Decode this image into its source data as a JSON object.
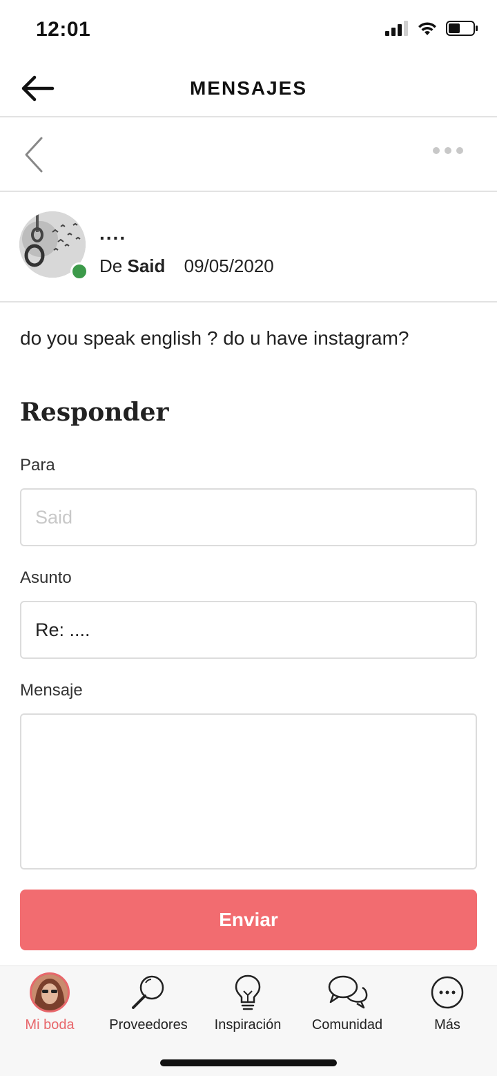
{
  "status_bar": {
    "time": "12:01"
  },
  "nav": {
    "title": "MENSAJES"
  },
  "message": {
    "subject": "....",
    "from_prefix": "De",
    "sender": "Said",
    "date": "09/05/2020",
    "body": "do you speak english ? do u have instagram?"
  },
  "reply": {
    "title": "Responder",
    "to_label": "Para",
    "to_placeholder": "Said",
    "subject_label": "Asunto",
    "subject_value": "Re: ....",
    "message_label": "Mensaje",
    "message_value": "",
    "send_label": "Enviar"
  },
  "tabs": [
    {
      "label": "Mi boda",
      "icon": "avatar-icon",
      "active": true
    },
    {
      "label": "Proveedores",
      "icon": "magnifier-icon",
      "active": false
    },
    {
      "label": "Inspiración",
      "icon": "lightbulb-icon",
      "active": false
    },
    {
      "label": "Comunidad",
      "icon": "chat-bubbles-icon",
      "active": false
    },
    {
      "label": "Más",
      "icon": "more-circle-icon",
      "active": false
    }
  ],
  "colors": {
    "accent": "#f26c70",
    "tab_active": "#e8676b",
    "online": "#3c9a4a"
  }
}
